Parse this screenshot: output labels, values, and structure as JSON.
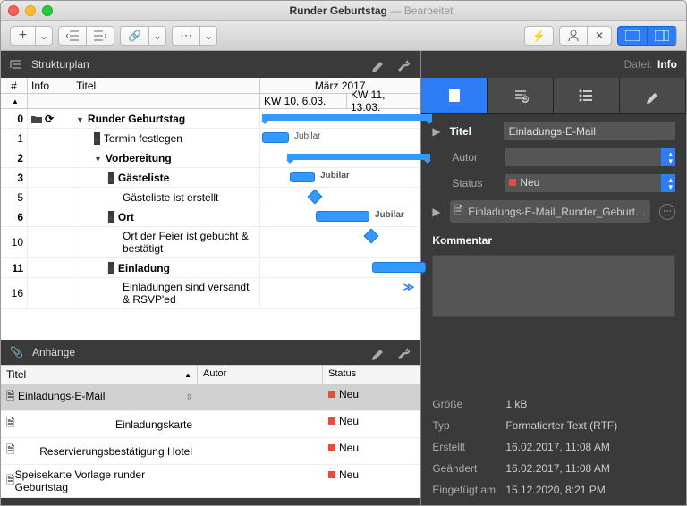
{
  "window": {
    "title": "Runder Geburtstag",
    "state": "Bearbeitet"
  },
  "toolbar": {
    "plus": "+"
  },
  "leftPane": {
    "header": "Strukturplan",
    "columns": {
      "num": "#",
      "info": "Info",
      "titel": "Titel"
    },
    "timeHeader": "März 2017",
    "weeks": {
      "w10": "KW 10, 6.03.",
      "w11": "KW 11, 13.03."
    },
    "rows": [
      {
        "n": "0",
        "t": "Runder Geburtstag",
        "bold": true,
        "arrow": "down",
        "icons": true
      },
      {
        "n": "1",
        "t": "Termin festlegen",
        "arrow": "right",
        "label": "Jubilar"
      },
      {
        "n": "2",
        "t": "Vorbereitung",
        "bold": true,
        "arrow": "down"
      },
      {
        "n": "3",
        "t": "Gästeliste",
        "bold": true,
        "arrow": "right",
        "label": "Jubilar"
      },
      {
        "n": "5",
        "t": "Gästeliste ist erstellt"
      },
      {
        "n": "6",
        "t": "Ort",
        "bold": true,
        "arrow": "right",
        "label": "Jubilar"
      },
      {
        "n": "10",
        "t": "Ort der Feier ist gebucht & bestätigt"
      },
      {
        "n": "11",
        "t": "Einladung",
        "bold": true,
        "arrow": "right"
      },
      {
        "n": "16",
        "t": "Einladungen sind versandt & RSVP'ed"
      }
    ],
    "moreIcon": "≫"
  },
  "attachments": {
    "header": "Anhänge",
    "cols": {
      "titel": "Titel",
      "autor": "Autor",
      "status": "Status"
    },
    "rows": [
      {
        "t": "Einladungs-E-Mail",
        "s": "Neu",
        "sel": true
      },
      {
        "t": "Einladungskarte",
        "s": "Neu"
      },
      {
        "t": "Reservierungsbestätigung Hotel",
        "s": "Neu"
      },
      {
        "t": "Speisekarte Vorlage runder Geburtstag",
        "s": "Neu"
      }
    ]
  },
  "inspector": {
    "breadcrumb": {
      "datei": "Datei:",
      "info": "Info"
    },
    "titel": {
      "label": "Titel",
      "value": "Einladungs-E-Mail"
    },
    "autor": {
      "label": "Autor",
      "value": ""
    },
    "status": {
      "label": "Status",
      "value": "Neu"
    },
    "filenode": "Einladungs-E-Mail_Runder_Geburt…",
    "kommentar": "Kommentar",
    "details": {
      "groesse": {
        "l": "Größe",
        "v": "1 kB"
      },
      "typ": {
        "l": "Typ",
        "v": "Formatierter Text (RTF)"
      },
      "erstellt": {
        "l": "Erstellt",
        "v": "16.02.2017, 11:08 AM"
      },
      "geaendert": {
        "l": "Geändert",
        "v": "16.02.2017, 11:08 AM"
      },
      "eingefuegt": {
        "l": "Eingefügt am",
        "v": "15.12.2020, 8:21 PM"
      }
    }
  }
}
